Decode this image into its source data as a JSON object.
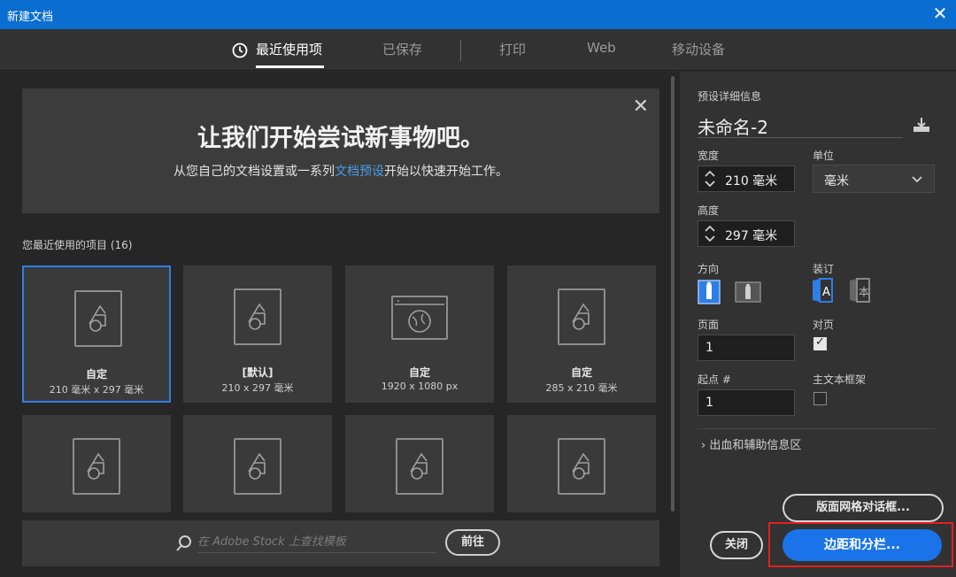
{
  "window": {
    "title": "新建文档",
    "close_glyph": "✕"
  },
  "tabs": [
    {
      "label": "最近使用项",
      "active": true
    },
    {
      "label": "已保存",
      "active": false
    },
    {
      "label": "打印",
      "active": false
    },
    {
      "label": "Web",
      "active": false
    },
    {
      "label": "移动设备",
      "active": false
    }
  ],
  "welcome": {
    "heading": "让我们开始尝试新事物吧。",
    "sub_before": "从您自己的文档设置或一系列",
    "sub_link": "文档预设",
    "sub_after": "开始以快速开始工作。",
    "close_glyph": "✕"
  },
  "recent": {
    "label": "您最近使用的项目",
    "count": "(16)",
    "items": [
      {
        "name": "自定",
        "dims": "210 毫米 x 297 毫米",
        "icon": "document-icon"
      },
      {
        "name": "[默认]",
        "dims": "210 x 297 毫米",
        "icon": "document-icon"
      },
      {
        "name": "自定",
        "dims": "1920 x 1080 px",
        "icon": "web-document-icon"
      },
      {
        "name": "自定",
        "dims": "285 x 210 毫米",
        "icon": "document-icon"
      }
    ]
  },
  "stock": {
    "placeholder": "在 Adobe Stock 上查找模板",
    "go_label": "前往"
  },
  "preset": {
    "header": "预设详细信息",
    "name": "未命名-2",
    "width_label": "宽度",
    "width_value": "210 毫米",
    "unit_label": "单位",
    "unit_value": "毫米",
    "height_label": "高度",
    "height_value": "297 毫米",
    "orientation_label": "方向",
    "binding_label": "装订",
    "pages_label": "页面",
    "pages_value": "1",
    "facing_label": "对页",
    "facing_checked": true,
    "start_label": "起点 #",
    "start_value": "1",
    "primary_frame_label": "主文本框架",
    "primary_frame_checked": false,
    "bleed_label": "出血和辅助信息区"
  },
  "buttons": {
    "layout_grid": "版面网格对话框...",
    "close": "关闭",
    "margins_columns": "边距和分栏..."
  },
  "colors": {
    "accent": "#1a73e8",
    "titlebar": "#0a6ed1",
    "highlight": "#e02020"
  }
}
